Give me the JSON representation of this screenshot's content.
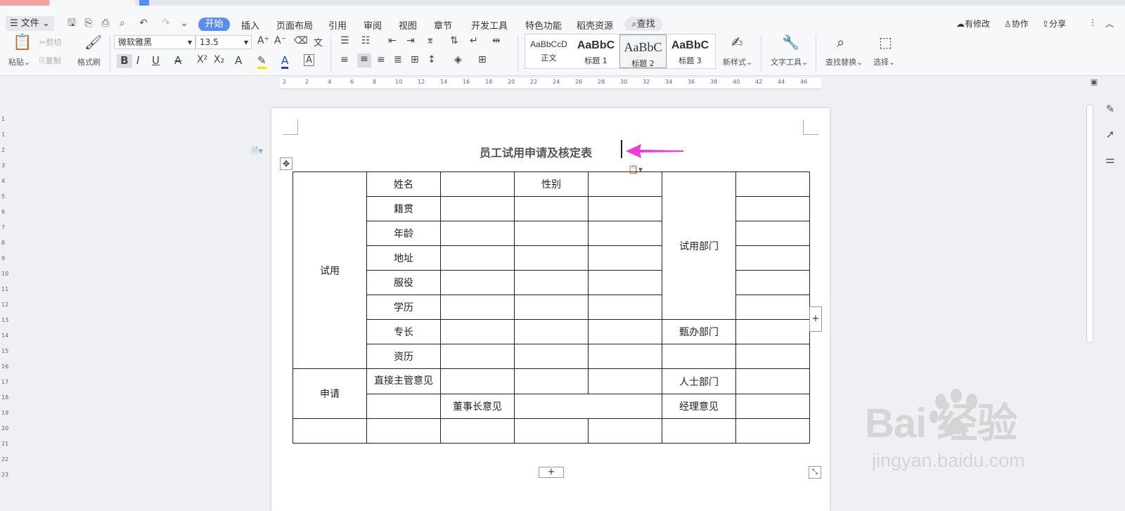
{
  "menu": {
    "file": "文件",
    "tabs": [
      "开始",
      "插入",
      "页面布局",
      "引用",
      "审阅",
      "视图",
      "章节",
      "开发工具",
      "特色功能",
      "稻壳资源"
    ],
    "search": "查找",
    "has_changes": "有修改",
    "collaborate": "协作",
    "share": "分享"
  },
  "ribbon": {
    "paste": "粘贴",
    "cut": "剪切",
    "copy": "复制",
    "format_painter": "格式刷",
    "font_name": "微软雅黑",
    "font_size": "13.5",
    "styles": [
      {
        "preview": "AaBbCcD",
        "name": "正文"
      },
      {
        "preview": "AaBbC",
        "name": "标题 1"
      },
      {
        "preview": "AaBbC",
        "name": "标题 2"
      },
      {
        "preview": "AaBbC",
        "name": "标题 3"
      }
    ],
    "new_style": "新样式",
    "text_tools": "文字工具",
    "find_replace": "查找替换",
    "select": "选择"
  },
  "ruler": [
    "2",
    "2",
    "4",
    "6",
    "8",
    "10",
    "12",
    "14",
    "16",
    "18",
    "20",
    "22",
    "24",
    "26",
    "28",
    "30",
    "32",
    "34",
    "36",
    "38",
    "40",
    "42",
    "44",
    "46"
  ],
  "vruler": [
    "1",
    "1",
    "2",
    "3",
    "4",
    "5",
    "6",
    "7",
    "8",
    "9",
    "10",
    "11",
    "12",
    "13",
    "14",
    "15",
    "16",
    "17",
    "18",
    "19",
    "20",
    "21",
    "22",
    "23"
  ],
  "document": {
    "title": "员工试用申请及核定表",
    "cells": {
      "trial": "试用",
      "name": "姓名",
      "gender": "性别",
      "native": "籍贯",
      "age": "年龄",
      "address": "地址",
      "service": "服役",
      "education": "学历",
      "specialty": "专长",
      "experience": "资历",
      "trial_dept": "试用部门",
      "handling_dept": "甄办部门",
      "apply": "申请",
      "supervisor": "直接主管意见",
      "hr_dept": "人士部门",
      "chairman": "董事长意见",
      "manager": "经理意见"
    }
  },
  "watermark": {
    "main": "Bai  经验",
    "sub": "jingyan.baidu.com"
  },
  "colors": {
    "accent": "#5b8def",
    "arrow": "#e83fd6"
  }
}
